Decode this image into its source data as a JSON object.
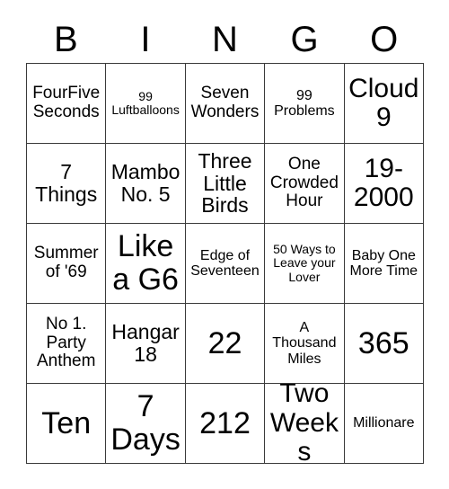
{
  "card": {
    "header_letters": [
      "B",
      "I",
      "N",
      "G",
      "O"
    ],
    "rows": [
      [
        {
          "text": "FourFive Seconds",
          "size": "md"
        },
        {
          "text": "99 Luftballoons",
          "size": "xs"
        },
        {
          "text": "Seven Wonders",
          "size": "md"
        },
        {
          "text": "99 Problems",
          "size": "sm"
        },
        {
          "text": "Cloud 9",
          "size": "xl"
        }
      ],
      [
        {
          "text": "7 Things",
          "size": "lg"
        },
        {
          "text": "Mambo No. 5",
          "size": "lg"
        },
        {
          "text": "Three Little Birds",
          "size": "lg"
        },
        {
          "text": "One Crowded Hour",
          "size": "md"
        },
        {
          "text": "19-2000",
          "size": "xl"
        }
      ],
      [
        {
          "text": "Summer of '69",
          "size": "md"
        },
        {
          "text": "Like a G6",
          "size": "xxl"
        },
        {
          "text": "Edge of Seventeen",
          "size": "sm"
        },
        {
          "text": "50 Ways to Leave your Lover",
          "size": "xs"
        },
        {
          "text": "Baby One More Time",
          "size": "sm"
        }
      ],
      [
        {
          "text": "No 1. Party Anthem",
          "size": "md"
        },
        {
          "text": "Hangar 18",
          "size": "lg"
        },
        {
          "text": "22",
          "size": "xxl"
        },
        {
          "text": "A Thousand Miles",
          "size": "sm"
        },
        {
          "text": "365",
          "size": "xxl"
        }
      ],
      [
        {
          "text": "Ten",
          "size": "xxl"
        },
        {
          "text": "7 Days",
          "size": "xxl"
        },
        {
          "text": "212",
          "size": "xxl"
        },
        {
          "text": "Two Weeks",
          "size": "xl"
        },
        {
          "text": "Millionare",
          "size": "sm"
        }
      ]
    ],
    "colors": {
      "border": "#3a3a3a",
      "background": "#ffffff",
      "text": "#000000"
    }
  }
}
